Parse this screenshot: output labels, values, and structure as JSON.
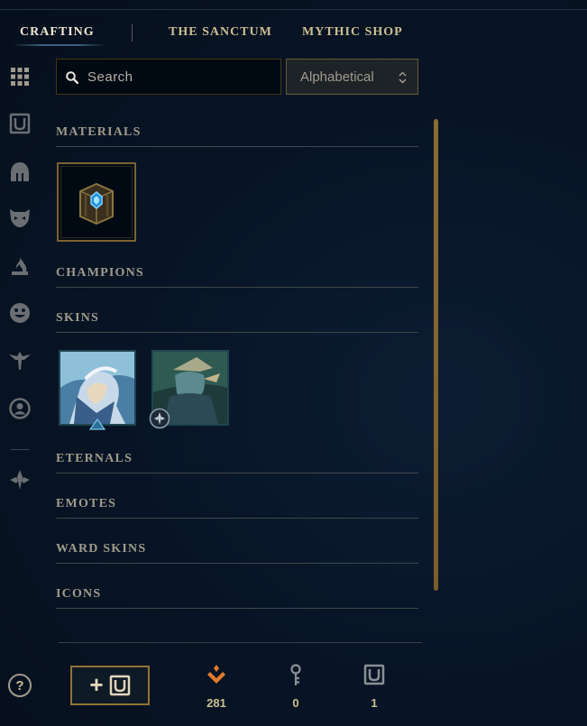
{
  "tabs": [
    {
      "label": "CRAFTING",
      "active": true
    },
    {
      "label": "THE SANCTUM",
      "active": false
    },
    {
      "label": "MYTHIC SHOP",
      "active": false
    }
  ],
  "sidebar": {
    "icons": [
      "grid-icon",
      "chest-icon",
      "helmet-icon",
      "mask-icon",
      "flame-icon",
      "smiley-icon",
      "ward-icon",
      "profile-icon",
      "eternals-icon"
    ]
  },
  "search": {
    "placeholder": "Search",
    "value": ""
  },
  "sort": {
    "selected": "Alphabetical"
  },
  "sections": {
    "materials": "MATERIALS",
    "champions": "CHAMPIONS",
    "skins": "SKINS",
    "eternals": "ETERNALS",
    "emotes": "EMOTES",
    "ward_skins": "WARD SKINS",
    "icons": "ICONS"
  },
  "materials": [
    {
      "name": "hextech-chest",
      "count": null
    }
  ],
  "skins": [
    {
      "name": "skin-shard-1"
    },
    {
      "name": "skin-shard-2"
    }
  ],
  "help_label": "?",
  "currencies": {
    "orange_essence": {
      "icon": "orange-essence-icon",
      "count": "281",
      "color": "#e07a2b"
    },
    "keys": {
      "icon": "key-icon",
      "count": "0"
    },
    "chests": {
      "icon": "chest-icon",
      "count": "1"
    }
  },
  "colors": {
    "gold": "#cdbe91",
    "accent_border": "#7b6231",
    "bg": "#081527"
  }
}
